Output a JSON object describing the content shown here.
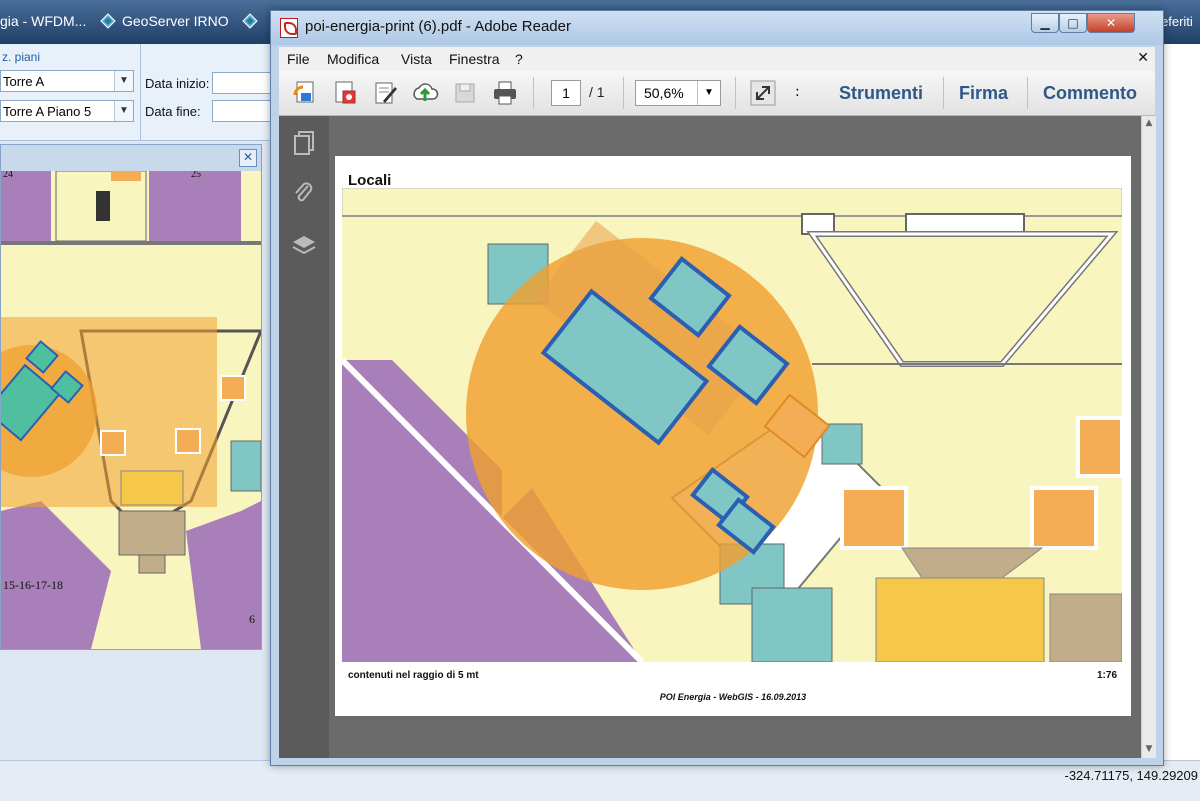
{
  "browser": {
    "tabs": [
      {
        "label": "gia - WFDM..."
      },
      {
        "label": "GeoServer IRNO"
      }
    ],
    "right_label": "eferiti",
    "coordinates": "-324.71175, 149.29209"
  },
  "panel": {
    "header": "z. piani",
    "tower_value": "Torre A",
    "floor_value": "Torre A Piano 5",
    "start_label": "Data inizio:",
    "end_label": "Data fine:",
    "map_label": "15-16-17-18",
    "map_label_right": "6",
    "map_label_top_left": "24",
    "map_label_top_right": "25"
  },
  "reader": {
    "title": "poi-energia-print (6).pdf - Adobe Reader",
    "menu": {
      "file": "File",
      "modifica": "Modifica",
      "vista": "Vista",
      "finestra": "Finestra",
      "help": "?"
    },
    "page_current": "1",
    "page_total": "/ 1",
    "zoom": "50,6%",
    "tools": {
      "strumenti": "Strumenti",
      "firma": "Firma",
      "commento": "Commento"
    },
    "document": {
      "title": "Locali",
      "caption": "contenuti nel raggio di 5 mt",
      "scale": "1:76",
      "footer": "POI Energia - WebGIS - 16.09.2013"
    }
  },
  "colors": {
    "accent": "#2f5787",
    "purple_room": "#a87fb9",
    "yellow_room": "#f9f5bf",
    "orange_room": "#f5ad55",
    "teal_room": "#7fc6c4",
    "selection": "#f0a030",
    "highlight_border": "#2b5fb4"
  }
}
